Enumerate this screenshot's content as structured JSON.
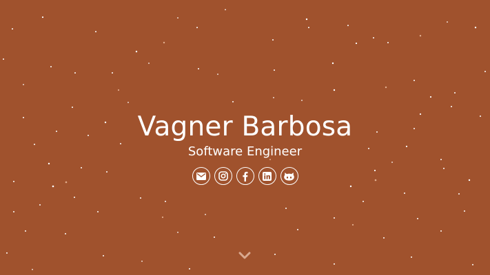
{
  "theme": {
    "background": "#a0522d",
    "foreground": "#ffffff",
    "chevron": "#d9a98f"
  },
  "hero": {
    "name": "Vagner Barbosa",
    "title": "Software Engineer"
  },
  "socials": [
    {
      "icon": "envelope-icon"
    },
    {
      "icon": "instagram-icon"
    },
    {
      "icon": "facebook-icon"
    },
    {
      "icon": "linkedin-icon"
    },
    {
      "icon": "github-icon"
    }
  ],
  "scroll": {
    "icon": "chevron-down-icon"
  }
}
